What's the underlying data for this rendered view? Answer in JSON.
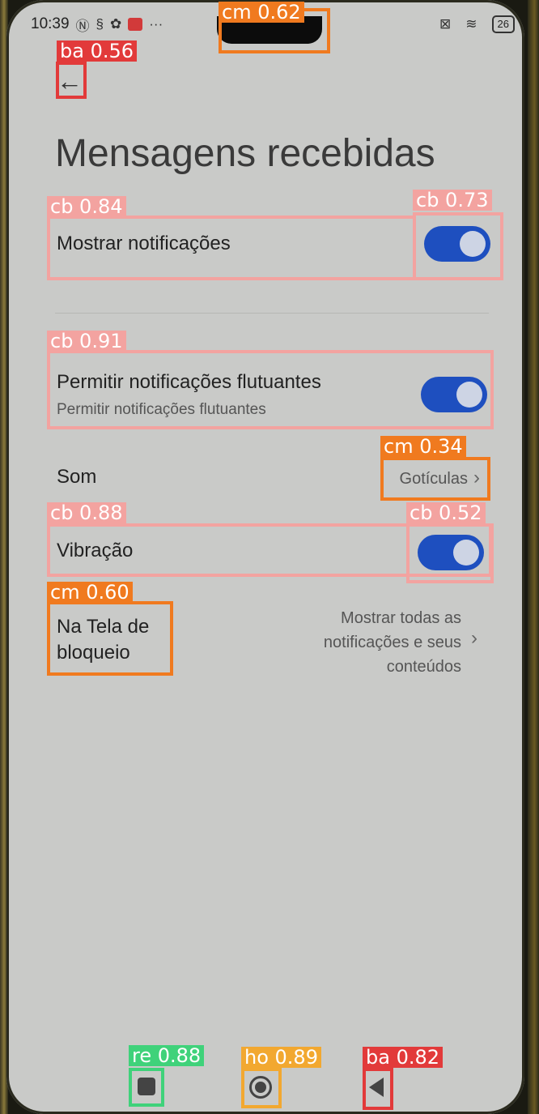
{
  "status_bar": {
    "time": "10:39",
    "icons": [
      "nfc-icon",
      "sim-icon",
      "settings-icon",
      "mail-icon",
      "more-icon"
    ],
    "battery": "26"
  },
  "page": {
    "title": "Mensagens recebidas",
    "back_icon": "←"
  },
  "settings": {
    "show_notifications": {
      "label": "Mostrar notificações",
      "enabled": true
    },
    "floating": {
      "label": "Permitir notificações flutuantes",
      "sublabel": "Permitir notificações flutuantes",
      "enabled": true
    },
    "sound": {
      "label": "Som",
      "value": "Gotículas"
    },
    "vibration": {
      "label": "Vibração",
      "enabled": true
    },
    "lock_screen": {
      "label_line1": "Na Tela de",
      "label_line2": "bloqueio",
      "value_line1": "Mostrar todas as",
      "value_line2": "notificações e seus",
      "value_line3": "conteúdos"
    }
  },
  "detections": {
    "notch": "cm 0.62",
    "back": "ba 0.56",
    "show_notifications_row": "cb 0.84",
    "show_notifications_toggle": "cb 0.73",
    "floating_row": "cb 0.91",
    "sound_value": "cm 0.34",
    "vibration_row": "cb 0.88",
    "vibration_toggle": "cb 0.52",
    "lock_screen": "cm 0.60",
    "recents": "re 0.88",
    "home": "ho 0.89",
    "nav_back": "ba 0.82"
  },
  "nav": {
    "recents_icon": "square-icon",
    "home_icon": "circle-icon",
    "back_icon": "triangle-back-icon"
  }
}
